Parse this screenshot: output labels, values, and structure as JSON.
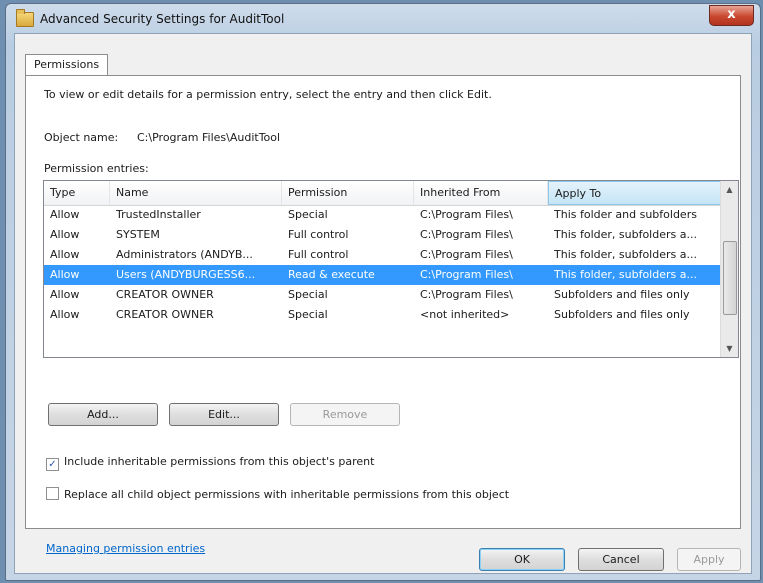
{
  "window": {
    "title": "Advanced Security Settings for AuditTool",
    "close_label": "x"
  },
  "tabs": [
    {
      "label": "Permissions"
    }
  ],
  "permissions": {
    "instruction": "To view or edit details for a permission entry, select the entry and then click Edit.",
    "object_name_label": "Object name:",
    "object_name_value": "C:\\Program Files\\AuditTool",
    "entries_label": "Permission entries:",
    "columns": [
      "Type",
      "Name",
      "Permission",
      "Inherited From",
      "Apply To"
    ],
    "rows": [
      {
        "type": "Allow",
        "name": "TrustedInstaller",
        "permission": "Special",
        "inherited": "C:\\Program Files\\",
        "apply": "This folder and subfolders"
      },
      {
        "type": "Allow",
        "name": "SYSTEM",
        "permission": "Full control",
        "inherited": "C:\\Program Files\\",
        "apply": "This folder, subfolders a..."
      },
      {
        "type": "Allow",
        "name": "Administrators (ANDYB...",
        "permission": "Full control",
        "inherited": "C:\\Program Files\\",
        "apply": "This folder, subfolders a..."
      },
      {
        "type": "Allow",
        "name": "Users (ANDYBURGESS6...",
        "permission": "Read & execute",
        "inherited": "C:\\Program Files\\",
        "apply": "This folder, subfolders a...",
        "selected": true
      },
      {
        "type": "Allow",
        "name": "CREATOR OWNER",
        "permission": "Special",
        "inherited": "C:\\Program Files\\",
        "apply": "Subfolders and files only"
      },
      {
        "type": "Allow",
        "name": "CREATOR OWNER",
        "permission": "Special",
        "inherited": "<not inherited>",
        "apply": "Subfolders and files only"
      }
    ],
    "buttons": {
      "add": "Add...",
      "edit": "Edit...",
      "remove": "Remove"
    },
    "include_inheritable_label": "Include inheritable permissions from this object's parent",
    "include_inheritable_checked": true,
    "replace_child_label": "Replace all child object permissions with inheritable permissions from this object",
    "replace_child_checked": false,
    "manage_link": "Managing permission entries"
  },
  "footer": {
    "ok": "OK",
    "cancel": "Cancel",
    "apply": "Apply"
  }
}
